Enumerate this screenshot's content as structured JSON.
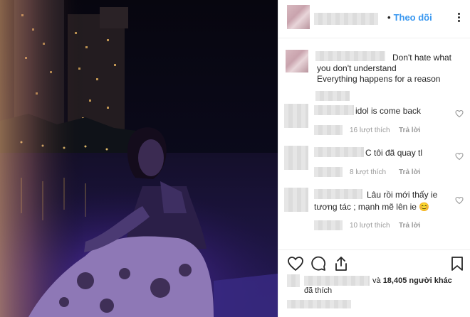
{
  "header": {
    "dot": "•",
    "follow_label": "Theo dõi",
    "more_icon": "more-horizontal-icon"
  },
  "caption": {
    "lines": [
      "Don't hate what",
      "you don't understand",
      "Everything happens for a reason"
    ]
  },
  "comments": [
    {
      "text": "idol is come back",
      "likes": "16 lượt thích",
      "reply": "Trả lời"
    },
    {
      "text": "C tôi đã quay tl",
      "likes": "8 lượt thích",
      "reply": "Trả lời"
    },
    {
      "text_line1": "Lâu rồi mới thấy ie",
      "text_line2": "tương tác ; mạnh mẽ lên ie",
      "emoji": "😊",
      "likes": "10 lượt thích",
      "reply": "Trả lời"
    }
  ],
  "actions": {
    "like_icon": "heart-outline-icon",
    "comment_icon": "comment-bubble-icon",
    "share_icon": "share-icon",
    "save_icon": "bookmark-icon"
  },
  "likes_summary": {
    "and": "và",
    "count": "18,405 người khác",
    "suffix": "đã thích"
  },
  "colors": {
    "link_blue": "#3897f0",
    "text": "#262626",
    "muted": "#999999"
  }
}
